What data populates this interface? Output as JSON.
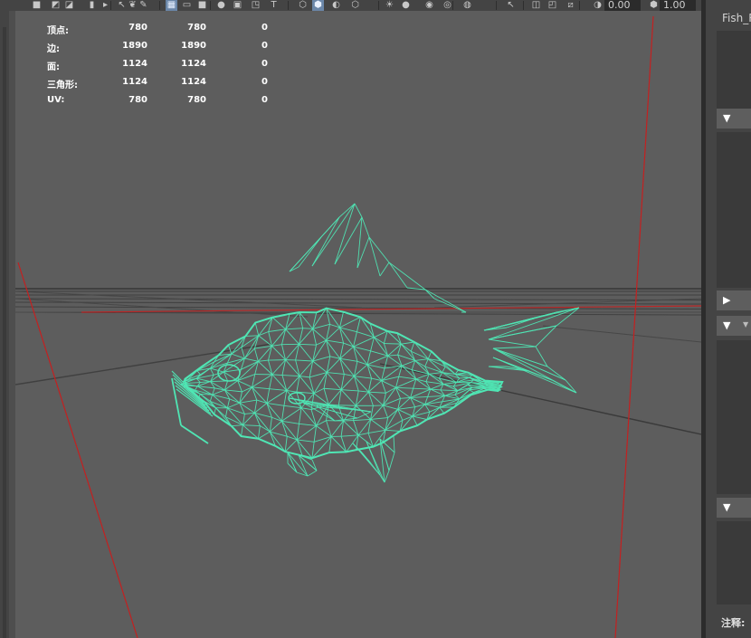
{
  "toolbar": {
    "icons": [
      "camera-icon",
      "camera-attr-icon",
      "bookmark-icon",
      "flag-icon",
      "bookmark2-icon",
      "select-icon",
      "lasso-icon",
      "paint-icon",
      "grid-icon",
      "film-gate-icon",
      "resolution-gate-icon",
      "safe-action-icon",
      "field-chart-icon",
      "safe-title-icon",
      "text-icon",
      "wireframe-icon",
      "smooth-shade-icon",
      "textured-icon",
      "lights-icon",
      "shadows-icon",
      "ao-icon",
      "motion-blur-icon",
      "aa-icon",
      "dof-icon",
      "isolate-icon",
      "xray-icon",
      "xray-joints-icon",
      "backface-icon",
      "exposure-icon",
      "gamma-icon"
    ],
    "exposure": "0.00",
    "gamma": "1.00"
  },
  "stats": {
    "rows": [
      {
        "label": "顶点:",
        "v1": "780",
        "v2": "780",
        "v3": "0"
      },
      {
        "label": "边:",
        "v1": "1890",
        "v2": "1890",
        "v3": "0"
      },
      {
        "label": "面:",
        "v1": "1124",
        "v2": "1124",
        "v3": "0"
      },
      {
        "label": "三角形:",
        "v1": "1124",
        "v2": "1124",
        "v3": "0"
      },
      {
        "label": "UV:",
        "v1": "780",
        "v2": "780",
        "v3": "0"
      }
    ]
  },
  "right_panel": {
    "title": "Fish_R",
    "notes_label": "注释:"
  },
  "colors": {
    "viewport_bg": "#5d5d5d",
    "wire": "#4fe6b4",
    "axis_red": "#c42020",
    "panel_bg": "#444444",
    "toolbar_active": "#6a86a8"
  }
}
